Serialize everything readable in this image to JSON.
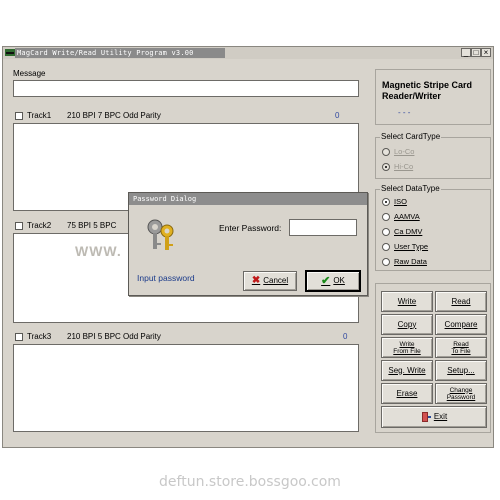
{
  "window": {
    "title": "MagCard Write/Read Utility Program v3.00",
    "controls": [
      "_",
      "□",
      "×"
    ]
  },
  "message": {
    "label": "Message",
    "value": ""
  },
  "tracks": [
    {
      "label": "Track1",
      "spec": "210 BPI  7 BPC  Odd Parity",
      "count": "0"
    },
    {
      "label": "Track2",
      "spec": "75 BPI  5 BPC",
      "count": ""
    },
    {
      "label": "Track3",
      "spec": "210 BPI  5 BPC  Odd Parity",
      "count": "0"
    }
  ],
  "device": {
    "title": "Magnetic Stripe Card Reader/Writer",
    "status": "- - -"
  },
  "card_type": {
    "title": "Select CardType",
    "options": [
      "Lo-Co",
      "Hi-Co"
    ],
    "selected": "Hi-Co"
  },
  "data_type": {
    "title": "Select DataType",
    "options": [
      "ISO",
      "AAMVA",
      "Ca DMV",
      "User Type",
      "Raw Data"
    ],
    "selected": "ISO"
  },
  "buttons": {
    "write": "Write",
    "read": "Read",
    "copy": "Copy",
    "compare": "Compare",
    "write_from_file_1": "Write",
    "write_from_file_2": "From File",
    "read_to_file_1": "Read",
    "read_to_file_2": "To File",
    "seg_write": "Seg. Write",
    "setup": "Setup...",
    "erase": "Erase",
    "change_password_1": "Change",
    "change_password_2": "Password",
    "exit": "Exit"
  },
  "dialog": {
    "title": "Password Dialog",
    "password_label": "Enter Password:",
    "password_value": "",
    "hint": "Input password",
    "cancel": "Cancel",
    "ok": "OK"
  },
  "watermark_text": "WWW.",
  "footer": "deftun.store.bossgoo.com",
  "colors": {
    "title_bar": "#8a8a8a",
    "window_bg": "#d8d4cc",
    "counter": "#3048a0",
    "hint": "#1a3a8a"
  }
}
